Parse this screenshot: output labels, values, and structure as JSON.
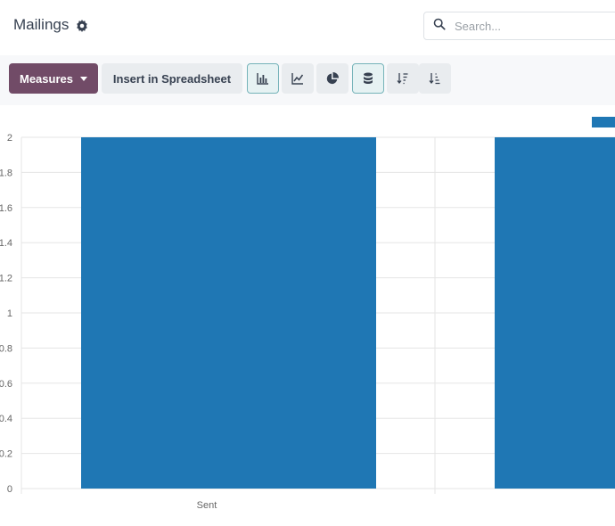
{
  "header": {
    "breadcrumb": "Mailings",
    "search_placeholder": "Search..."
  },
  "toolbar": {
    "measures_label": "Measures",
    "insert_label": "Insert in Spreadsheet",
    "icons": [
      "bar-chart-icon",
      "line-chart-icon",
      "pie-chart-icon",
      "stacked-icon",
      "sort-descending-icon",
      "sort-ascending-icon"
    ]
  },
  "colors": {
    "brand": "#714b67",
    "bar": "#1f77b4",
    "active_border": "#75b3b9"
  },
  "chart_data": {
    "type": "bar",
    "categories": [
      "Sent",
      ""
    ],
    "values": [
      2,
      2
    ],
    "ylim": [
      0,
      2
    ],
    "yticks": [
      "0",
      "0.2",
      "0.4",
      "0.6",
      "0.8",
      "1",
      "1.2",
      "1.4",
      "1.6",
      "1.8",
      "2"
    ],
    "grid": true,
    "legend": "top-right"
  }
}
